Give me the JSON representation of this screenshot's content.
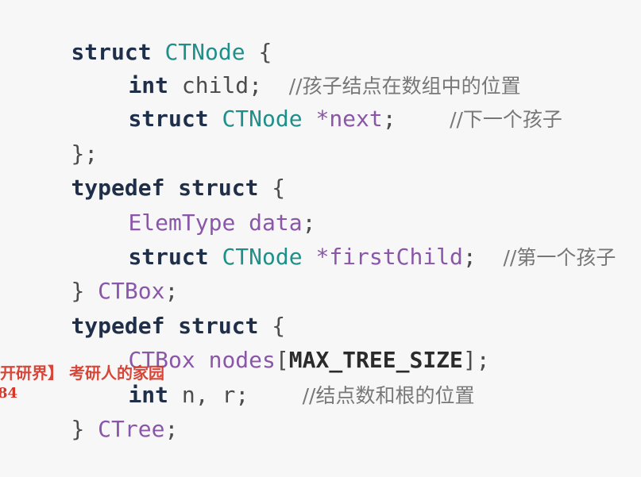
{
  "editor": {
    "lines": [
      {
        "tokens": [
          {
            "text": "struct ",
            "kind": "kw"
          },
          {
            "text": "CTNode",
            "kind": "type"
          },
          {
            "text": " {",
            "kind": "punct"
          }
        ]
      },
      {
        "tokens": [
          {
            "text": "int ",
            "kind": "kw"
          },
          {
            "text": "child",
            "kind": "ident"
          },
          {
            "text": ";  ",
            "kind": "punct"
          },
          {
            "text": "//孩子结点在数组中的位置",
            "kind": "comment"
          }
        ]
      },
      {
        "tokens": [
          {
            "text": "struct ",
            "kind": "kw"
          },
          {
            "text": "CTNode",
            "kind": "type"
          },
          {
            "text": " *next",
            "kind": "member"
          },
          {
            "text": ";    ",
            "kind": "punct"
          },
          {
            "text": "//下一个孩子",
            "kind": "comment"
          }
        ]
      },
      {
        "tokens": [
          {
            "text": "};",
            "kind": "punct"
          }
        ]
      },
      {
        "tokens": [
          {
            "text": "typedef ",
            "kind": "kw"
          },
          {
            "text": "struct",
            "kind": "kw"
          },
          {
            "text": " {",
            "kind": "punct"
          }
        ]
      },
      {
        "tokens": [
          {
            "text": "ElemType",
            "kind": "member"
          },
          {
            "text": " data",
            "kind": "member"
          },
          {
            "text": ";",
            "kind": "punct"
          }
        ]
      },
      {
        "tokens": [
          {
            "text": "struct ",
            "kind": "kw"
          },
          {
            "text": "CTNode",
            "kind": "type"
          },
          {
            "text": " *firstChild",
            "kind": "member"
          },
          {
            "text": ";  ",
            "kind": "punct"
          },
          {
            "text": "//第一个孩子",
            "kind": "comment"
          }
        ]
      },
      {
        "tokens": [
          {
            "text": "} ",
            "kind": "punct"
          },
          {
            "text": "CTBox",
            "kind": "member"
          },
          {
            "text": ";",
            "kind": "punct"
          }
        ]
      },
      {
        "tokens": [
          {
            "text": "typedef ",
            "kind": "kw"
          },
          {
            "text": "struct",
            "kind": "kw"
          },
          {
            "text": " {",
            "kind": "punct"
          }
        ]
      },
      {
        "tokens": [
          {
            "text": "CTBox",
            "kind": "member"
          },
          {
            "text": " nodes",
            "kind": "member"
          },
          {
            "text": "[",
            "kind": "punct"
          },
          {
            "text": "MAX_TREE_SIZE",
            "kind": "constant"
          },
          {
            "text": "];",
            "kind": "punct"
          }
        ]
      },
      {
        "tokens": [
          {
            "text": "int ",
            "kind": "kw"
          },
          {
            "text": "n, r",
            "kind": "ident"
          },
          {
            "text": ";    ",
            "kind": "punct"
          },
          {
            "text": "//结点数和根的位置",
            "kind": "comment"
          }
        ]
      },
      {
        "tokens": [
          {
            "text": "} ",
            "kind": "punct"
          },
          {
            "text": "CTree",
            "kind": "member"
          },
          {
            "text": ";",
            "kind": "punct"
          }
        ]
      }
    ]
  },
  "overlay": {
    "watermark_text": "开研界】 考研人的家园",
    "watermark_prefix": "84"
  },
  "colors": {
    "background": "#f7f7f8",
    "keyword": "#1f2f49",
    "type": "#1f8f8a",
    "member": "#8a56a8",
    "comment": "#777777",
    "watermark": "#d53728"
  }
}
